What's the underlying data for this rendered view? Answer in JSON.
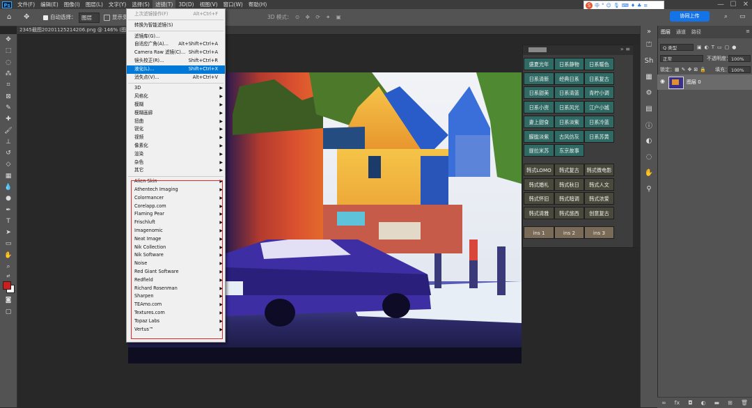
{
  "menubar": {
    "logo": "Ps",
    "items": [
      "文件(F)",
      "编辑(E)",
      "图像(I)",
      "图层(L)",
      "文字(Y)",
      "选择(S)",
      "滤镜(T)",
      "3D(D)",
      "视图(V)",
      "窗口(W)",
      "帮助(H)"
    ],
    "active_index": 6,
    "window_controls": [
      "—",
      "☐",
      "✕"
    ]
  },
  "ime": {
    "logo": "S",
    "label": "中",
    "extras": [
      "°",
      "☺",
      "🎙",
      "⌨",
      "♦",
      "♣",
      "≡"
    ]
  },
  "options_bar": {
    "auto_select": "自动选择：",
    "auto_select_value": "图层",
    "show_transform": "显示变",
    "mode_3d": "3D 模式：",
    "cloud_button": "协同上传"
  },
  "document": {
    "tab_title": "2345截图20201125214206.png @ 146% (图层 0, RGB/8#)"
  },
  "filter_menu": {
    "items": [
      {
        "label": "上次滤镜操作(F)",
        "shortcut": "Alt+Ctrl+F",
        "disabled": true
      },
      {
        "sep": true
      },
      {
        "label": "转换为智能滤镜(S)"
      },
      {
        "sep": true
      },
      {
        "label": "滤镜库(G)..."
      },
      {
        "label": "自适应广角(A)...",
        "shortcut": "Alt+Shift+Ctrl+A"
      },
      {
        "label": "Camera Raw 滤镜(C)...",
        "shortcut": "Shift+Ctrl+A"
      },
      {
        "label": "镜头校正(R)...",
        "shortcut": "Shift+Ctrl+R"
      },
      {
        "label": "液化(L)...",
        "shortcut": "Shift+Ctrl+X",
        "highlighted": true
      },
      {
        "label": "消失点(V)...",
        "shortcut": "Alt+Ctrl+V"
      },
      {
        "sep": true
      },
      {
        "label": "3D",
        "sub": true
      },
      {
        "label": "风格化",
        "sub": true
      },
      {
        "label": "模糊",
        "sub": true
      },
      {
        "label": "模糊画廊",
        "sub": true
      },
      {
        "label": "扭曲",
        "sub": true
      },
      {
        "label": "锐化",
        "sub": true
      },
      {
        "label": "视频",
        "sub": true
      },
      {
        "label": "像素化",
        "sub": true
      },
      {
        "label": "渲染",
        "sub": true
      },
      {
        "label": "杂色",
        "sub": true
      },
      {
        "label": "其它",
        "sub": true
      },
      {
        "sep": true
      },
      {
        "label": "Alien Skin",
        "sub": true
      },
      {
        "label": "Athentech Imaging",
        "sub": true
      },
      {
        "label": "Colormancer",
        "sub": true
      },
      {
        "label": "Corelapp.com",
        "sub": true
      },
      {
        "label": "Flaming Pear",
        "sub": true
      },
      {
        "label": "Frischluft",
        "sub": true
      },
      {
        "label": "Imagenomic",
        "sub": true
      },
      {
        "label": "Neat Image",
        "sub": true
      },
      {
        "label": "Nik Collection",
        "sub": true
      },
      {
        "label": "Nik Software",
        "sub": true
      },
      {
        "label": "Noise",
        "sub": true
      },
      {
        "label": "Red Giant Software",
        "sub": true
      },
      {
        "label": "Redfield",
        "sub": true
      },
      {
        "label": "Richard Rosenman",
        "sub": true
      },
      {
        "label": "Sharpen",
        "sub": true
      },
      {
        "label": "TEAmo.com",
        "sub": true
      },
      {
        "label": "Textures.com",
        "sub": true
      },
      {
        "label": "Topaz Labs",
        "sub": true
      },
      {
        "label": "Vertus™",
        "sub": true
      }
    ]
  },
  "preset_panel": {
    "teal_rows": [
      [
        "盛夏光年",
        "日系静物",
        "日系暖色"
      ],
      [
        "日系清新",
        "经典日系",
        "日系复古"
      ],
      [
        "日系甜美",
        "日系清蓝",
        "青柠小调"
      ],
      [
        "日系小资",
        "日系风光",
        "江户小城"
      ],
      [
        "妻上甜食",
        "日系淡紫",
        "日系冷蓝"
      ],
      [
        "朦胧淡紫",
        "古风仿灰",
        "日系苏黄"
      ],
      [
        "提拉米苏",
        "东京故事"
      ]
    ],
    "gray_rows": [
      [
        "韩式LOMO",
        "韩式复古",
        "韩式微电影"
      ],
      [
        "韩式婚礼",
        "韩式秋日",
        "韩式人文"
      ],
      [
        "韩式怀旧",
        "韩式暗调",
        "韩式浓爱"
      ],
      [
        "韩式清雅",
        "韩式旅西",
        "创意复古"
      ]
    ],
    "tan_row": [
      "ins 1",
      "ins 2",
      "ins 3"
    ]
  },
  "layers_panel": {
    "tabs": [
      "图层",
      "通道",
      "路径"
    ],
    "kind_filter": "Q 类型",
    "blend_mode": "正常",
    "opacity_label": "不透明度：",
    "opacity_value": "100%",
    "lock_label": "锁定：",
    "fill_label": "填充：",
    "fill_value": "100%",
    "layer_name": "图层 0"
  },
  "colors": {
    "menu_highlight": "#0078d7",
    "red_box": "#e02828",
    "teal": "#2f6b64",
    "cloud_button": "#1473e6",
    "foreground": "#d01c1c",
    "background": "#ffffff"
  }
}
